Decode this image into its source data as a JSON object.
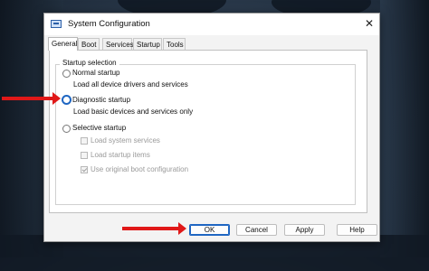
{
  "window": {
    "title": "System Configuration",
    "close_glyph": "✕"
  },
  "tabs": [
    "General",
    "Boot",
    "Services",
    "Startup",
    "Tools"
  ],
  "group": {
    "label": "Startup selection"
  },
  "options": {
    "normal": {
      "label": "Normal startup",
      "desc": "Load all device drivers and services"
    },
    "diagnostic": {
      "label": "Diagnostic startup",
      "desc": "Load basic devices and services only"
    },
    "selective": {
      "label": "Selective startup"
    }
  },
  "checks": [
    {
      "label": "Load system services",
      "checked": false
    },
    {
      "label": "Load startup items",
      "checked": false
    },
    {
      "label": "Use original boot configuration",
      "checked": true
    }
  ],
  "buttons": {
    "ok": "OK",
    "cancel": "Cancel",
    "apply": "Apply",
    "help": "Help"
  },
  "colors": {
    "arrow": "#e01818",
    "focus": "#1f66c2"
  }
}
